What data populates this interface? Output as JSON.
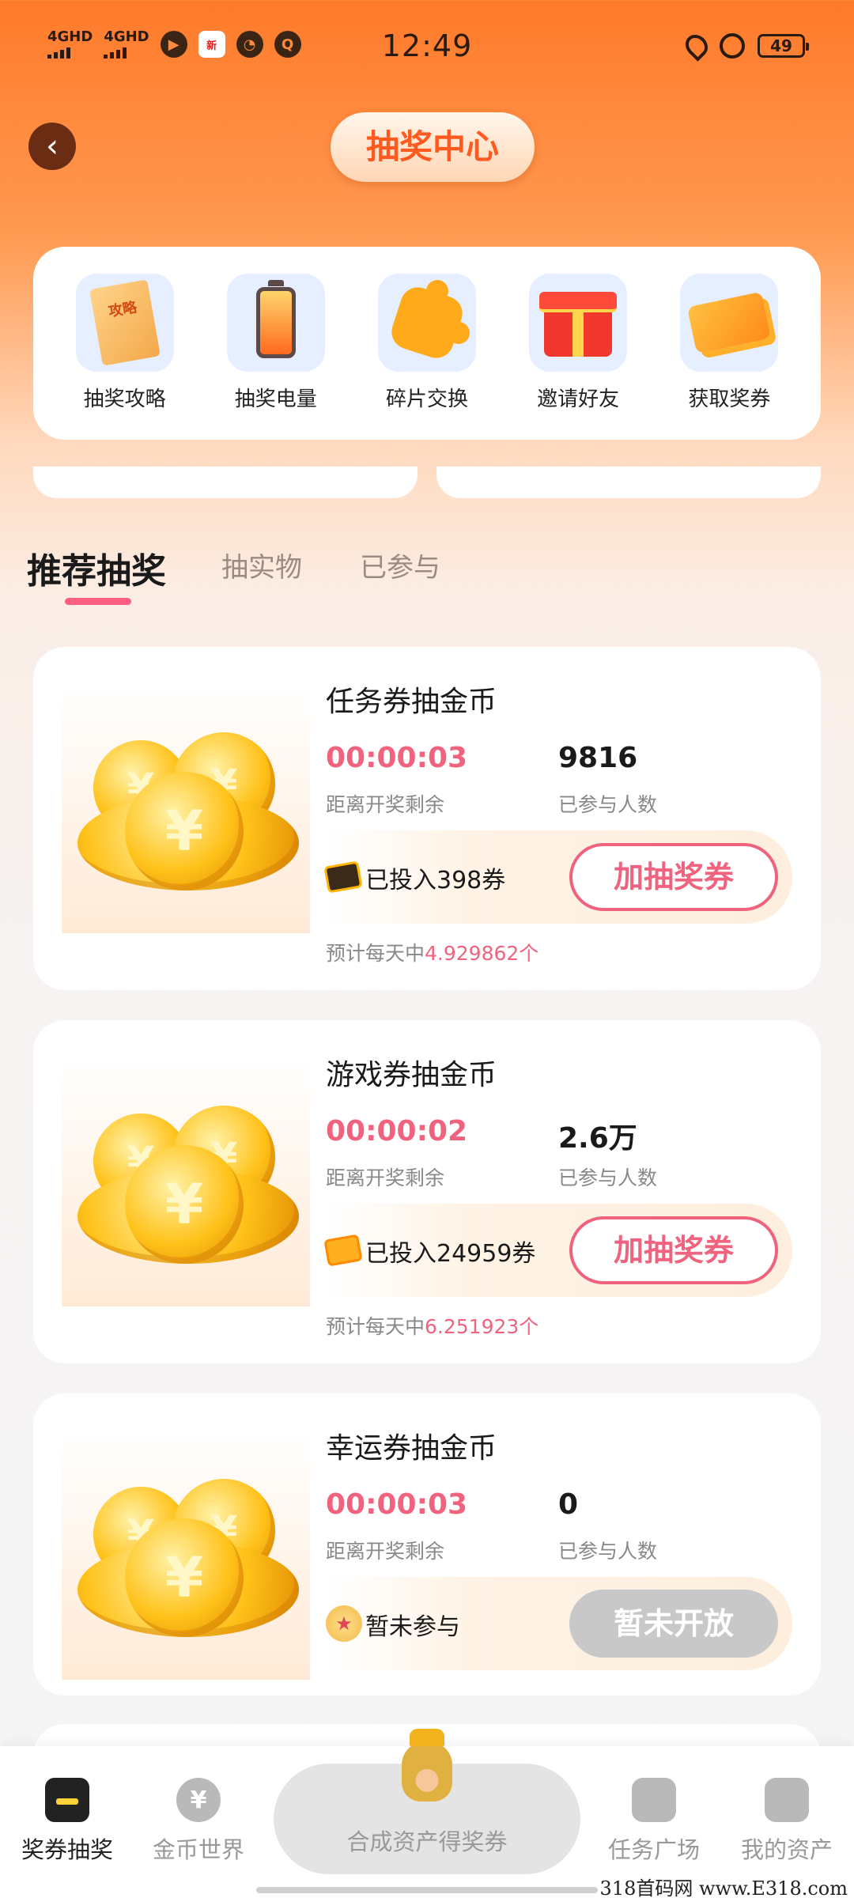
{
  "status_bar": {
    "network1": "4GHD",
    "network2": "4GHD",
    "time": "12:49",
    "battery": "49",
    "icons": [
      "play-icon",
      "news-app-icon",
      "speed-icon",
      "q-app-icon",
      "location-icon",
      "alarm-icon"
    ]
  },
  "header": {
    "title": "抽奖中心"
  },
  "quick_menu": [
    {
      "label": "抽奖攻略",
      "icon": "guide-book-icon",
      "icon_text": "攻略"
    },
    {
      "label": "抽奖电量",
      "icon": "battery-icon"
    },
    {
      "label": "碎片交换",
      "icon": "puzzle-icon"
    },
    {
      "label": "邀请好友",
      "icon": "gift-icon"
    },
    {
      "label": "获取奖券",
      "icon": "ticket-icon"
    }
  ],
  "tabs": [
    {
      "label": "推荐抽奖",
      "active": true
    },
    {
      "label": "抽实物",
      "active": false
    },
    {
      "label": "已参与",
      "active": false
    }
  ],
  "cards": [
    {
      "title": "任务券抽金币",
      "countdown": "00:00:03",
      "countdown_label": "距离开奖剩余",
      "participants": "9816",
      "participants_label": "已参与人数",
      "invested": "已投入398券",
      "button": "加抽奖券",
      "estimate_prefix": "预计每天中",
      "estimate_value": "4.929862个"
    },
    {
      "title": "游戏券抽金币",
      "countdown": "00:00:02",
      "countdown_label": "距离开奖剩余",
      "participants": "2.6万",
      "participants_label": "已参与人数",
      "invested": "已投入24959券",
      "button": "加抽奖券",
      "estimate_prefix": "预计每天中",
      "estimate_value": "6.251923个"
    },
    {
      "title": "幸运券抽金币",
      "countdown": "00:00:03",
      "countdown_label": "距离开奖剩余",
      "participants": "0",
      "participants_label": "已参与人数",
      "invested": "暂未参与",
      "button": "暂未开放"
    }
  ],
  "coin_symbol": "¥",
  "bottom_nav": {
    "items": [
      {
        "label": "奖券抽奖",
        "active": true
      },
      {
        "label": "金币世界",
        "active": false,
        "icon_text": "¥"
      },
      {
        "label": "任务广场",
        "active": false
      },
      {
        "label": "我的资产",
        "active": false
      }
    ],
    "center_label": "合成资产得奖券"
  },
  "watermark": "318首码网 www.E318.com",
  "colors": {
    "accent_pink": "#f0637f",
    "header_orange": "#ff7a2a",
    "title_orange": "#ff5a1f"
  }
}
